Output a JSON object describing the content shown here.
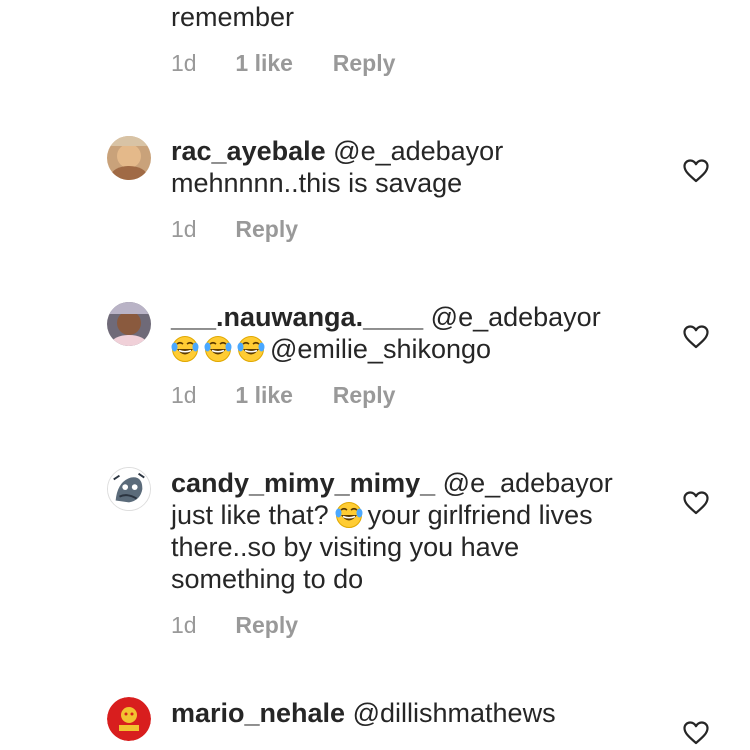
{
  "comments": [
    {
      "body_line": "remember",
      "time": "1d",
      "likes": "1 like",
      "reply": "Reply"
    },
    {
      "username": "rac_ayebale",
      "mention": "@e_adebayor",
      "body_lines": [
        "mehnnnn..this is savage"
      ],
      "time": "1d",
      "reply": "Reply",
      "avatar_icon": "avatar-photo",
      "like_icon": "heart-outline-icon"
    },
    {
      "username": "___.nauwanga.____",
      "mention": "@e_adebayor",
      "emojis": [
        "face-with-tears-of-joy",
        "face-with-tears-of-joy",
        "face-with-tears-of-joy"
      ],
      "body_mention": "@emilie_shikongo",
      "time": "1d",
      "likes": "1 like",
      "reply": "Reply",
      "avatar_icon": "avatar-photo",
      "like_icon": "heart-outline-icon"
    },
    {
      "username": "candy_mimy_mimy_",
      "mention": "@e_adebayor",
      "body_line_1_a": "just like that?",
      "body_line_1_emoji": "face-with-tears-of-joy",
      "body_line_1_b": "your girlfriend lives",
      "body_line_2": "there..so by visiting you have",
      "body_line_3": "something to do",
      "time": "1d",
      "reply": "Reply",
      "avatar_icon": "avatar-illustration",
      "like_icon": "heart-outline-icon"
    },
    {
      "username": "mario_nehale",
      "mention": "@dillishmathews",
      "avatar_icon": "avatar-red-logo",
      "like_icon": "heart-outline-icon"
    }
  ],
  "colors": {
    "text": "#262626",
    "meta": "#999999",
    "heart_stroke": "#262626",
    "background": "#ffffff"
  }
}
